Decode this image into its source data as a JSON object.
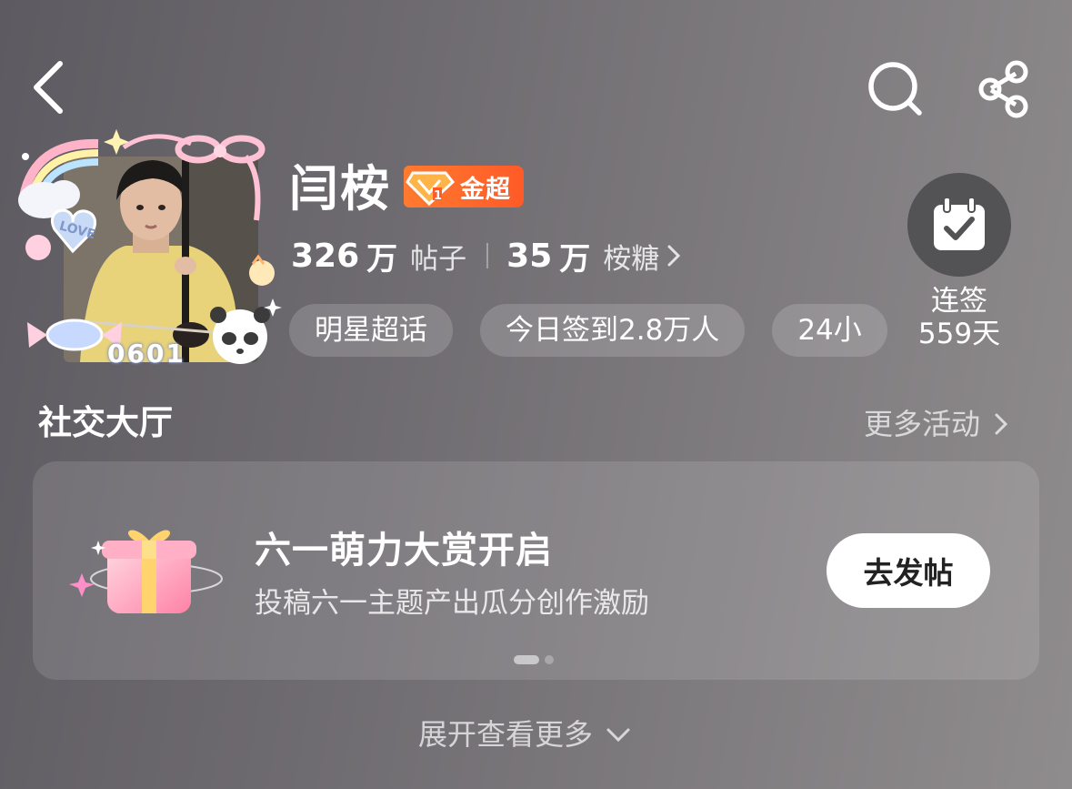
{
  "profile": {
    "name": "闫桉",
    "badge_label": "金超",
    "avatar_caption": "0601",
    "posts_count": "326",
    "posts_unit": "万",
    "posts_label": "帖子",
    "candy_count": "35",
    "candy_unit": "万",
    "candy_label": "桉糖"
  },
  "tags": [
    "明星超话",
    "今日签到2.8万人",
    "24小"
  ],
  "checkin": {
    "label": "连签",
    "days": "559天"
  },
  "section": {
    "title": "社交大厅",
    "more_label": "更多活动"
  },
  "promo": {
    "title": "六一萌力大赏开启",
    "subtitle": "投稿六一主题产出瓜分创作激励",
    "button_label": "去发帖"
  },
  "expand_label": "展开查看更多",
  "icons": {
    "back": "back-chevron-icon",
    "search": "search-icon",
    "share": "share-icon",
    "checkin": "calendar-check-icon"
  },
  "colors": {
    "badge": "#ff6a2c",
    "checkin_circle": "#535254"
  }
}
